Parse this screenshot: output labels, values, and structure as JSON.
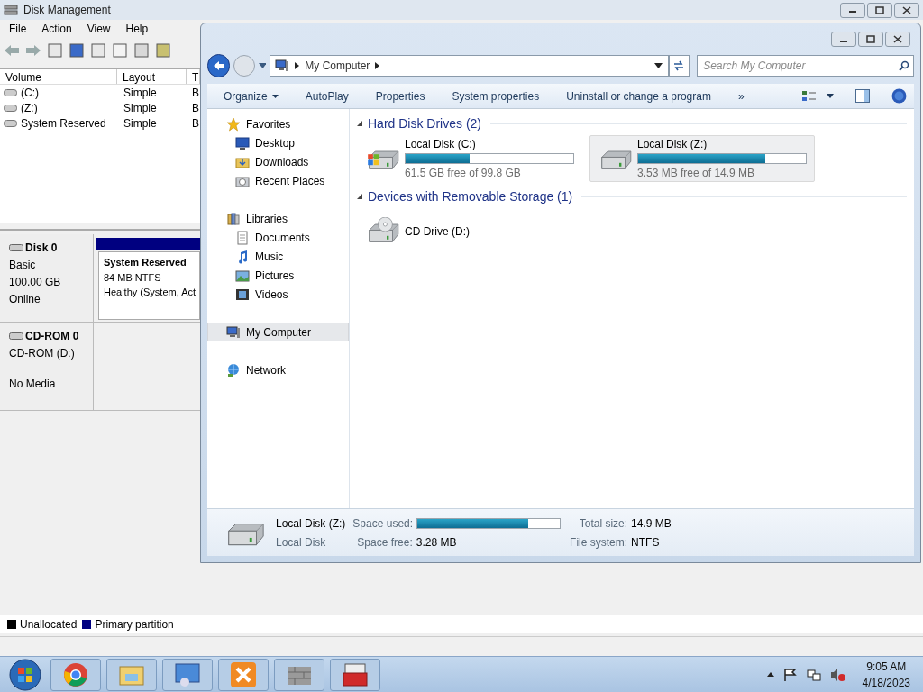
{
  "dm": {
    "title": "Disk Management",
    "menu": [
      "File",
      "Action",
      "View",
      "Help"
    ],
    "columns": [
      "Volume",
      "Layout",
      "T"
    ],
    "volumes": [
      {
        "cells": [
          "(C:)",
          "Simple",
          "B"
        ]
      },
      {
        "cells": [
          "(Z:)",
          "Simple",
          "B"
        ]
      },
      {
        "cells": [
          "System Reserved",
          "Simple",
          "B"
        ]
      }
    ],
    "disks": [
      {
        "kind": "disk",
        "name": "Disk 0",
        "lines": [
          "Basic",
          "100.00 GB",
          "Online"
        ],
        "partition": {
          "name": "System Reserved",
          "lines": [
            "84 MB NTFS",
            "Healthy (System, Act"
          ]
        }
      },
      {
        "kind": "cdrom",
        "name": "CD-ROM 0",
        "type": "CD-ROM (D:)",
        "status": "No Media"
      }
    ],
    "legend": [
      {
        "label": "Unallocated",
        "color": "#000000"
      },
      {
        "label": "Primary partition",
        "color": "#000080"
      }
    ]
  },
  "explorer": {
    "address": "My Computer",
    "search_placeholder": "Search My Computer",
    "commands": [
      {
        "label": "Organize",
        "dropdown": true
      },
      {
        "label": "AutoPlay",
        "dropdown": false
      },
      {
        "label": "Properties",
        "dropdown": false
      },
      {
        "label": "System properties",
        "dropdown": false
      },
      {
        "label": "Uninstall or change a program",
        "dropdown": false
      },
      {
        "label": "»",
        "dropdown": false
      }
    ],
    "nav": [
      {
        "label": "Favorites",
        "kind": "star",
        "selected": false,
        "children": [
          {
            "label": "Desktop",
            "kind": "desktop",
            "selected": false
          },
          {
            "label": "Downloads",
            "kind": "downloads",
            "selected": false
          },
          {
            "label": "Recent Places",
            "kind": "recent",
            "selected": false
          }
        ]
      },
      {
        "label": "Libraries",
        "kind": "library",
        "selected": false,
        "children": [
          {
            "label": "Documents",
            "kind": "documents",
            "selected": false
          },
          {
            "label": "Music",
            "kind": "music",
            "selected": false
          },
          {
            "label": "Pictures",
            "kind": "pictures",
            "selected": false
          },
          {
            "label": "Videos",
            "kind": "videos",
            "selected": false
          }
        ]
      },
      {
        "label": "My Computer",
        "kind": "computer",
        "selected": true
      },
      {
        "label": "Network",
        "kind": "network",
        "selected": false
      }
    ],
    "sections": [
      {
        "title": "Hard Disk Drives (2)",
        "items": [
          {
            "kind": "windows-drive",
            "name": "Local Disk (C:)",
            "level": 0.38,
            "free": "61.5 GB free of 99.8 GB",
            "selected": false
          },
          {
            "kind": "drive",
            "name": "Local Disk (Z:)",
            "level": 0.76,
            "free": "3.53 MB free of 14.9 MB",
            "selected": true
          }
        ]
      },
      {
        "title": "Devices with Removable Storage (1)",
        "items": [
          {
            "kind": "cd",
            "name": "CD Drive (D:)",
            "selected": false
          }
        ]
      }
    ],
    "details": {
      "name": "Local Disk (Z:)",
      "type": "Local Disk",
      "used_label": "Space used:",
      "level": 0.78,
      "free_label": "Space free:",
      "free": "3.28 MB",
      "total_label": "Total size:",
      "total": "14.9 MB",
      "fs_label": "File system:",
      "fs": "NTFS"
    }
  },
  "taskbar": {
    "time": "9:05 AM",
    "date": "4/18/2023"
  }
}
